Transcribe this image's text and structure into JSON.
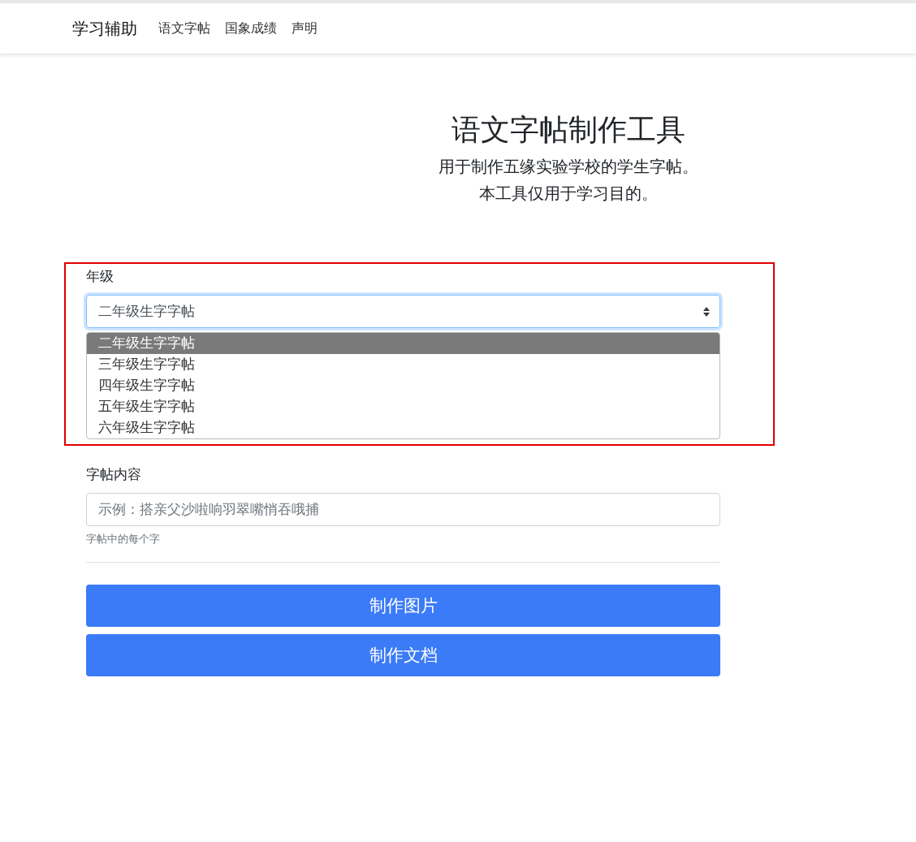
{
  "navbar": {
    "brand": "学习辅助",
    "links": [
      "语文字帖",
      "国象成绩",
      "声明"
    ]
  },
  "hero": {
    "title": "语文字帖制作工具",
    "lines": [
      "用于制作五缘实验学校的学生字帖。",
      "本工具仅用于学习目的。"
    ]
  },
  "form": {
    "grade": {
      "label": "年级",
      "value": "二年级生字字帖",
      "expanded": true,
      "options": [
        {
          "label": "二年级生字字帖",
          "selected": true
        },
        {
          "label": "三年级生字字帖",
          "selected": false
        },
        {
          "label": "四年级生字字帖",
          "selected": false
        },
        {
          "label": "五年级生字字帖",
          "selected": false
        },
        {
          "label": "六年级生字字帖",
          "selected": false
        }
      ]
    },
    "content": {
      "label": "字帖内容",
      "placeholder": "示例：搭亲父沙啦响羽翠嘴悄吞哦捕",
      "help": "字帖中的每个字"
    },
    "buttons": [
      "制作图片",
      "制作文档"
    ]
  },
  "highlight_frame": true
}
